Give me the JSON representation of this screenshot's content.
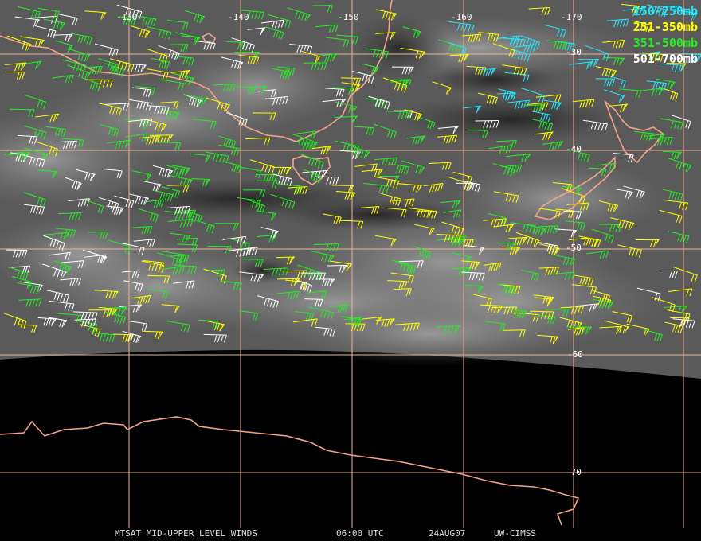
{
  "map": {
    "product": "MTSAT MID-UPPER LEVEL WINDS",
    "time": "06:00 UTC",
    "date": "24AUG07",
    "source": "UW-CIMSS",
    "colors": {
      "background": "#000000",
      "grid": "#f2b29a",
      "coast": "#f2a38a"
    },
    "longitude_labels": [
      "-130",
      "-140",
      "-150",
      "-160",
      "-170"
    ],
    "latitude_labels": [
      "-30",
      "-40",
      "-50",
      "-60",
      "-70"
    ]
  },
  "legend": [
    {
      "label": "150-250mb",
      "color": "#22e8ff"
    },
    {
      "label": "251-350mb",
      "color": "#ffff00"
    },
    {
      "label": "351-500mb",
      "color": "#22ee22"
    },
    {
      "label": "501-700mb",
      "color": "#ffffff"
    }
  ]
}
